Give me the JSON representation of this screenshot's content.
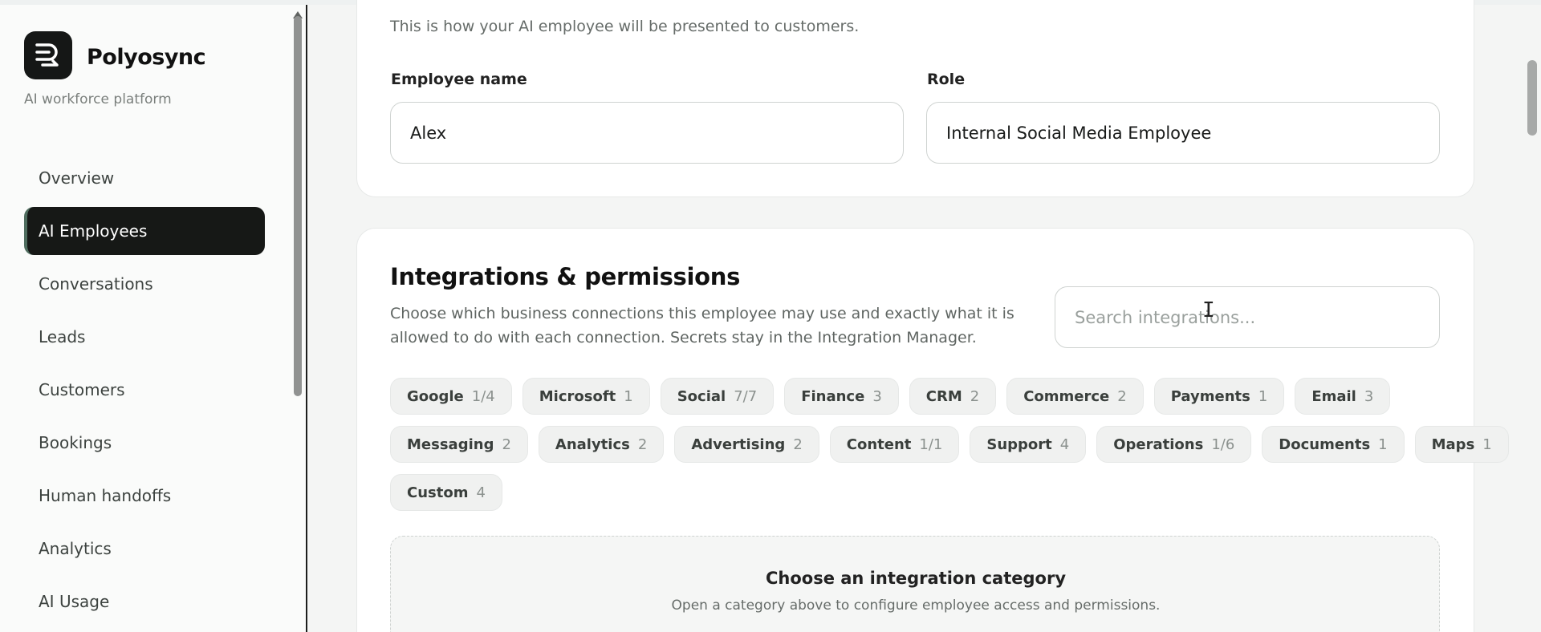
{
  "brand": {
    "name": "Polyosync",
    "subtitle": "AI workforce platform"
  },
  "nav": [
    {
      "label": "Overview",
      "active": false
    },
    {
      "label": "AI Employees",
      "active": true
    },
    {
      "label": "Conversations",
      "active": false
    },
    {
      "label": "Leads",
      "active": false
    },
    {
      "label": "Customers",
      "active": false
    },
    {
      "label": "Bookings",
      "active": false
    },
    {
      "label": "Human handoffs",
      "active": false
    },
    {
      "label": "Analytics",
      "active": false
    },
    {
      "label": "AI Usage",
      "active": false
    }
  ],
  "profile": {
    "description": "This is how your AI employee will be presented to customers.",
    "name_label": "Employee name",
    "name_value": "Alex",
    "role_label": "Role",
    "role_value": "Internal Social Media Employee"
  },
  "integrations": {
    "title": "Integrations & permissions",
    "description": "Choose which business connections this employee may use and exactly what it is allowed to do with each connection. Secrets stay in the Integration Manager.",
    "search_placeholder": "Search integrations...",
    "categories": [
      {
        "name": "Google",
        "count": "1/4"
      },
      {
        "name": "Microsoft",
        "count": "1"
      },
      {
        "name": "Social",
        "count": "7/7"
      },
      {
        "name": "Finance",
        "count": "3"
      },
      {
        "name": "CRM",
        "count": "2"
      },
      {
        "name": "Commerce",
        "count": "2"
      },
      {
        "name": "Payments",
        "count": "1"
      },
      {
        "name": "Email",
        "count": "3"
      },
      {
        "name": "Messaging",
        "count": "2"
      },
      {
        "name": "Analytics",
        "count": "2"
      },
      {
        "name": "Advertising",
        "count": "2"
      },
      {
        "name": "Content",
        "count": "1/1"
      },
      {
        "name": "Support",
        "count": "4"
      },
      {
        "name": "Operations",
        "count": "1/6"
      },
      {
        "name": "Documents",
        "count": "1"
      },
      {
        "name": "Maps",
        "count": "1"
      },
      {
        "name": "Custom",
        "count": "4"
      }
    ],
    "empty_title": "Choose an integration category",
    "empty_subtitle": "Open a category above to configure employee access and permissions."
  }
}
